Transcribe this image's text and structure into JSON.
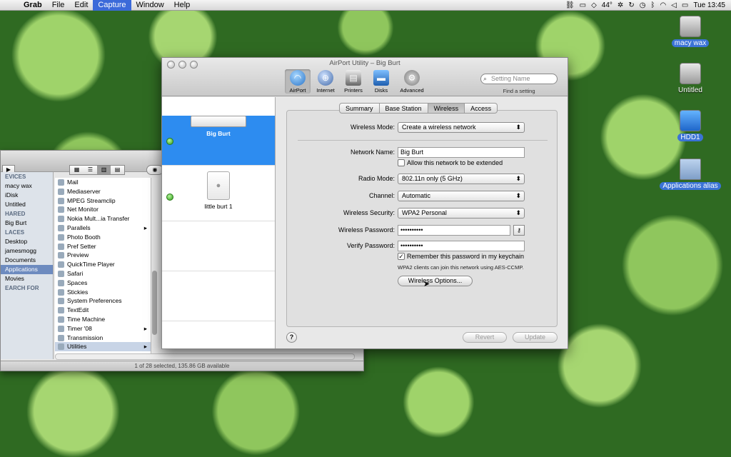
{
  "menubar": {
    "apple": "",
    "items": [
      "Grab",
      "File",
      "Edit",
      "Capture",
      "Window",
      "Help"
    ],
    "battery": "44°",
    "clock": "Tue 13:45"
  },
  "desktop": {
    "icons": [
      {
        "label": "macy wax",
        "kind": "disk",
        "selected": true
      },
      {
        "label": "Untitled",
        "kind": "disk",
        "selected": false
      },
      {
        "label": "HDD1",
        "kind": "network",
        "selected": true
      },
      {
        "label": "Applications alias",
        "kind": "folder",
        "selected": true
      }
    ]
  },
  "finder": {
    "sidebar": [
      {
        "text": "EVICES",
        "header": true
      },
      {
        "text": "macy wax"
      },
      {
        "text": "iDisk"
      },
      {
        "text": "Untitled"
      },
      {
        "text": "HARED",
        "header": true
      },
      {
        "text": "Big Burt"
      },
      {
        "text": "LACES",
        "header": true
      },
      {
        "text": "Desktop"
      },
      {
        "text": "jamesmogg"
      },
      {
        "text": "Documents"
      },
      {
        "text": "Applications",
        "selected": true
      },
      {
        "text": "Movies"
      },
      {
        "text": "EARCH FOR",
        "header": true
      }
    ],
    "apps": [
      {
        "name": "Mail"
      },
      {
        "name": "Mediaserver"
      },
      {
        "name": "MPEG Streamclip"
      },
      {
        "name": "Net Monitor"
      },
      {
        "name": "Nokia Mult...ia Transfer"
      },
      {
        "name": "Parallels",
        "folder": true
      },
      {
        "name": "Photo Booth"
      },
      {
        "name": "Pref Setter"
      },
      {
        "name": "Preview"
      },
      {
        "name": "QuickTime Player"
      },
      {
        "name": "Safari"
      },
      {
        "name": "Spaces"
      },
      {
        "name": "Stickies"
      },
      {
        "name": "System Preferences"
      },
      {
        "name": "TextEdit"
      },
      {
        "name": "Time Machine"
      },
      {
        "name": "Timer '08",
        "folder": true
      },
      {
        "name": "Transmission"
      },
      {
        "name": "Utilities",
        "folder": true,
        "selected": true
      }
    ],
    "status": "1 of 28 selected, 135.86 GB available"
  },
  "airport": {
    "title": "AirPort Utility – Big Burt",
    "tools": [
      "AirPort",
      "Internet",
      "Printers",
      "Disks",
      "Advanced"
    ],
    "search_placeholder": "Setting Name",
    "find_label": "Find a setting",
    "devices": [
      {
        "name": "Big Burt",
        "selected": true
      },
      {
        "name": "little burt 1",
        "selected": false
      }
    ],
    "tabs": [
      "Summary",
      "Base Station",
      "Wireless",
      "Access"
    ],
    "selected_tab": "Wireless",
    "form": {
      "wireless_mode_label": "Wireless Mode:",
      "wireless_mode_value": "Create a wireless network",
      "network_name_label": "Network Name:",
      "network_name_value": "Big Burt",
      "allow_extend_label": "Allow this network to be extended",
      "radio_mode_label": "Radio Mode:",
      "radio_mode_value": "802.11n only (5 GHz)",
      "channel_label": "Channel:",
      "channel_value": "Automatic",
      "security_label": "Wireless Security:",
      "security_value": "WPA2 Personal",
      "password_label": "Wireless Password:",
      "password_value": "••••••••••",
      "verify_label": "Verify Password:",
      "verify_value": "••••••••••",
      "remember_label": "Remember this password in my keychain",
      "note": "WPA2 clients can join this network using AES-CCMP.",
      "options_button": "Wireless Options..."
    },
    "revert_button": "Revert",
    "update_button": "Update",
    "help_label": "?"
  }
}
